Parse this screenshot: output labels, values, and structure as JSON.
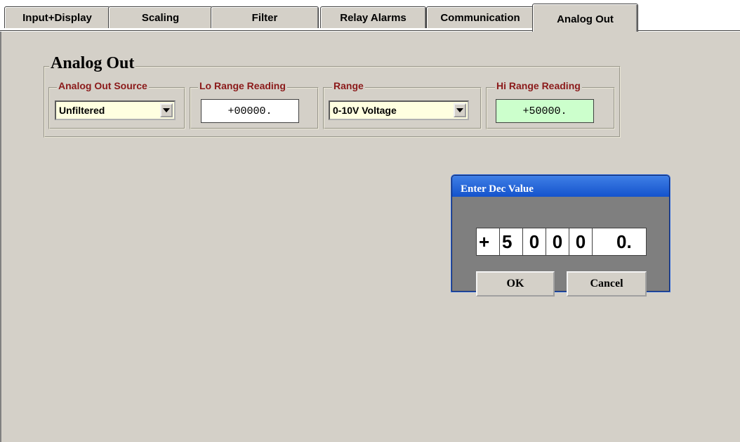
{
  "tabs": [
    {
      "label": "Input+Display"
    },
    {
      "label": "Scaling"
    },
    {
      "label": "Filter"
    },
    {
      "label": "Relay Alarms"
    },
    {
      "label": "Communication"
    },
    {
      "label": "Analog Out"
    }
  ],
  "active_tab": "Analog Out",
  "group": {
    "title": "Analog Out",
    "source": {
      "label": "Analog Out Source",
      "value": "Unfiltered"
    },
    "lo_range": {
      "label": "Lo Range Reading",
      "value": "+00000."
    },
    "range": {
      "label": "Range",
      "value": "0-10V Voltage"
    },
    "hi_range": {
      "label": "Hi Range Reading",
      "value": "+50000."
    }
  },
  "dialog": {
    "title": "Enter Dec Value",
    "digits": [
      "+",
      "5",
      "0",
      "0",
      "0",
      "0."
    ],
    "ok_label": "OK",
    "cancel_label": "Cancel"
  },
  "colors": {
    "panel_bg": "#d4d0c8",
    "group_label": "#8b1a1a",
    "combo_bg": "#ffffe0",
    "hi_field_bg": "#ccffcc",
    "dialog_title": "#1453cc"
  },
  "icons": {
    "combo_button": "dropdown-arrow-icon"
  }
}
